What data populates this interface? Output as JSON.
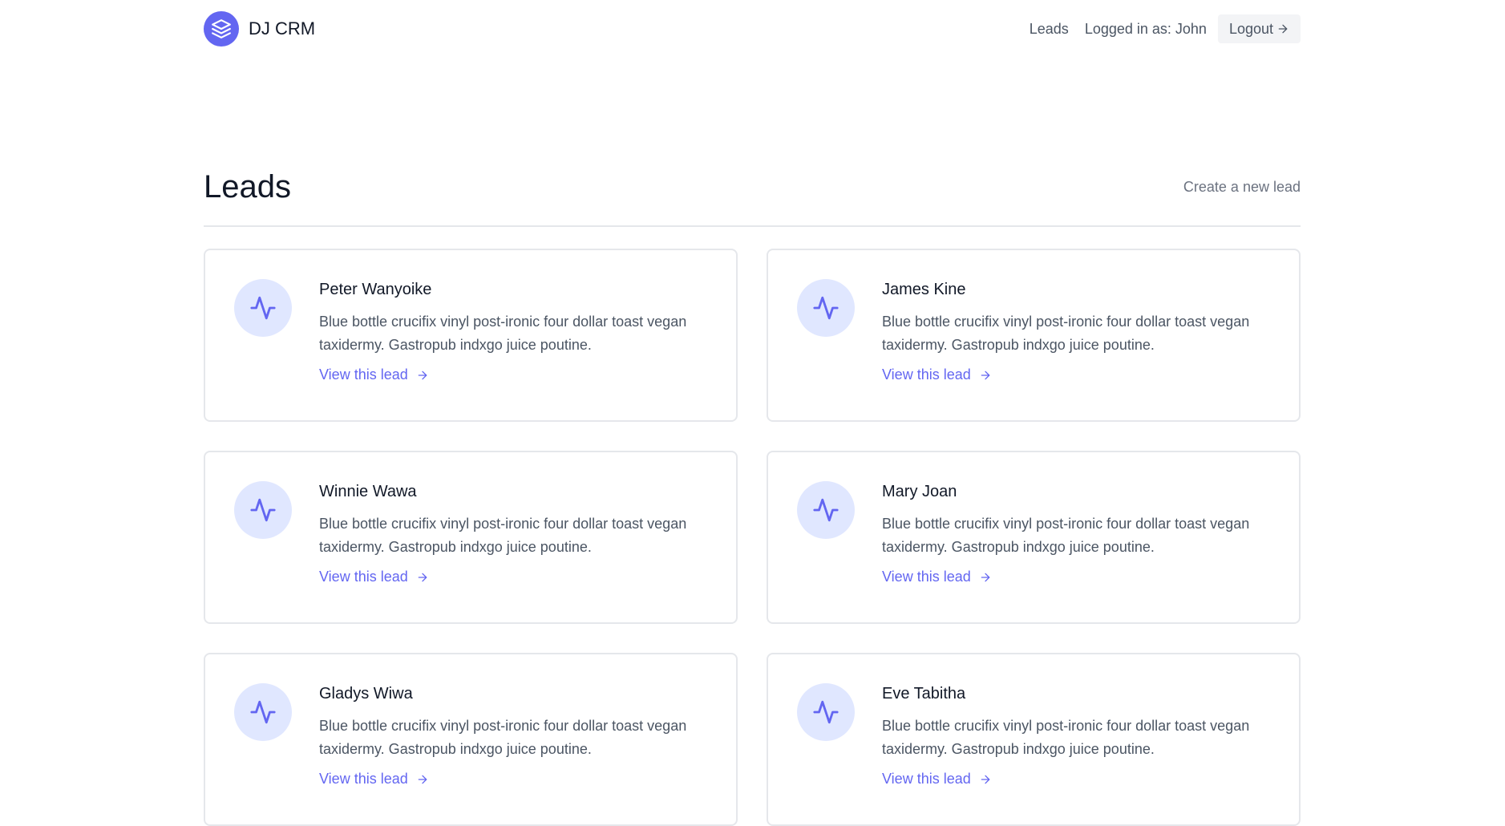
{
  "header": {
    "brand_name": "DJ CRM",
    "nav_leads": "Leads",
    "logged_in_text": "Logged in as: John",
    "logout_label": "Logout"
  },
  "page": {
    "title": "Leads",
    "create_link": "Create a new lead"
  },
  "leads": [
    {
      "name": "Peter Wanyoike",
      "description": "Blue bottle crucifix vinyl post-ironic four dollar toast vegan taxidermy. Gastropub indxgo juice poutine.",
      "link": "View this lead"
    },
    {
      "name": "James Kine",
      "description": "Blue bottle crucifix vinyl post-ironic four dollar toast vegan taxidermy. Gastropub indxgo juice poutine.",
      "link": "View this lead"
    },
    {
      "name": "Winnie Wawa",
      "description": "Blue bottle crucifix vinyl post-ironic four dollar toast vegan taxidermy. Gastropub indxgo juice poutine.",
      "link": "View this lead"
    },
    {
      "name": "Mary Joan",
      "description": "Blue bottle crucifix vinyl post-ironic four dollar toast vegan taxidermy. Gastropub indxgo juice poutine.",
      "link": "View this lead"
    },
    {
      "name": "Gladys Wiwa",
      "description": "Blue bottle crucifix vinyl post-ironic four dollar toast vegan taxidermy. Gastropub indxgo juice poutine.",
      "link": "View this lead"
    },
    {
      "name": "Eve Tabitha",
      "description": "Blue bottle crucifix vinyl post-ironic four dollar toast vegan taxidermy. Gastropub indxgo juice poutine.",
      "link": "View this lead"
    }
  ],
  "colors": {
    "accent": "#6366f1",
    "icon_bg": "#e0e7ff"
  },
  "icons": {
    "brand": "layers-icon",
    "lead": "activity-icon",
    "link_arrow": "arrow-right-icon"
  }
}
